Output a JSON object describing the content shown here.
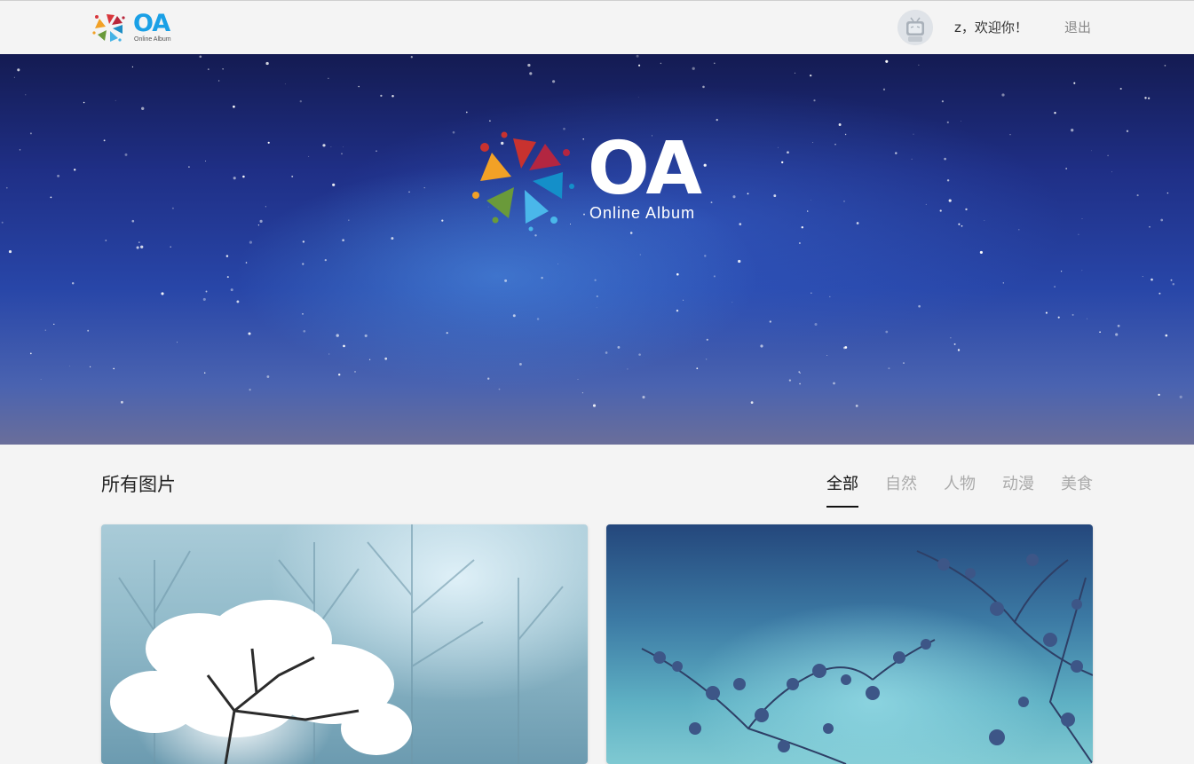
{
  "header": {
    "logo_text": "OA",
    "logo_sub": "Online Album",
    "greeting": "z，欢迎你！",
    "logout_label": "退出"
  },
  "banner": {
    "logo_text": "OA",
    "logo_sub": "Online Album"
  },
  "section": {
    "title": "所有图片",
    "tabs": [
      {
        "label": "全部",
        "active": true
      },
      {
        "label": "自然",
        "active": false
      },
      {
        "label": "人物",
        "active": false
      },
      {
        "label": "动漫",
        "active": false
      },
      {
        "label": "美食",
        "active": false
      }
    ]
  },
  "colors": {
    "accent": "#1aa0e6",
    "active_tab": "#111111",
    "inactive_tab": "#aaaaaa"
  },
  "icons": {
    "logo": "camera-aperture-logo-icon",
    "avatar": "bilibili-tv-avatar-icon"
  }
}
